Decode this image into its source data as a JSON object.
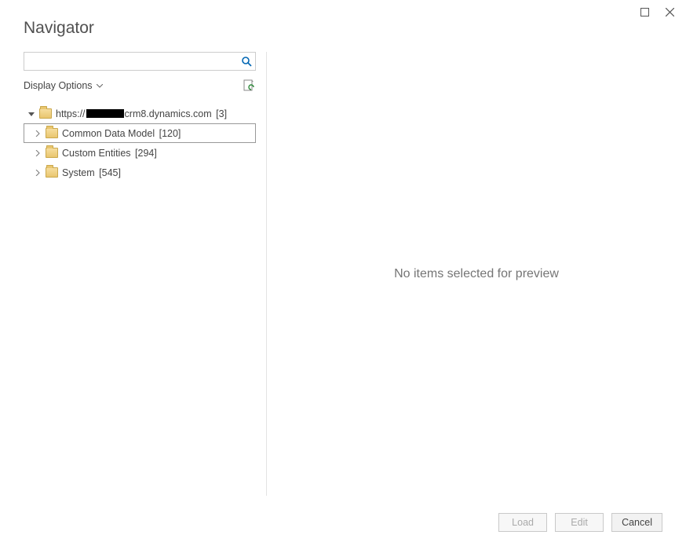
{
  "titlebar": {
    "maximize_icon": "maximize-icon",
    "close_icon": "close-icon"
  },
  "header": {
    "title": "Navigator"
  },
  "search": {
    "value": "",
    "placeholder": ""
  },
  "options": {
    "display_label": "Display Options"
  },
  "tree": {
    "root": {
      "url_prefix": "https://",
      "url_suffix": "crm8.dynamics.com",
      "count": "[3]"
    },
    "children": [
      {
        "label": "Common Data Model",
        "count": "[120]",
        "selected": true
      },
      {
        "label": "Custom Entities",
        "count": "[294]",
        "selected": false
      },
      {
        "label": "System",
        "count": "[545]",
        "selected": false
      }
    ]
  },
  "preview": {
    "empty_text": "No items selected for preview"
  },
  "footer": {
    "load": "Load",
    "edit": "Edit",
    "cancel": "Cancel"
  }
}
